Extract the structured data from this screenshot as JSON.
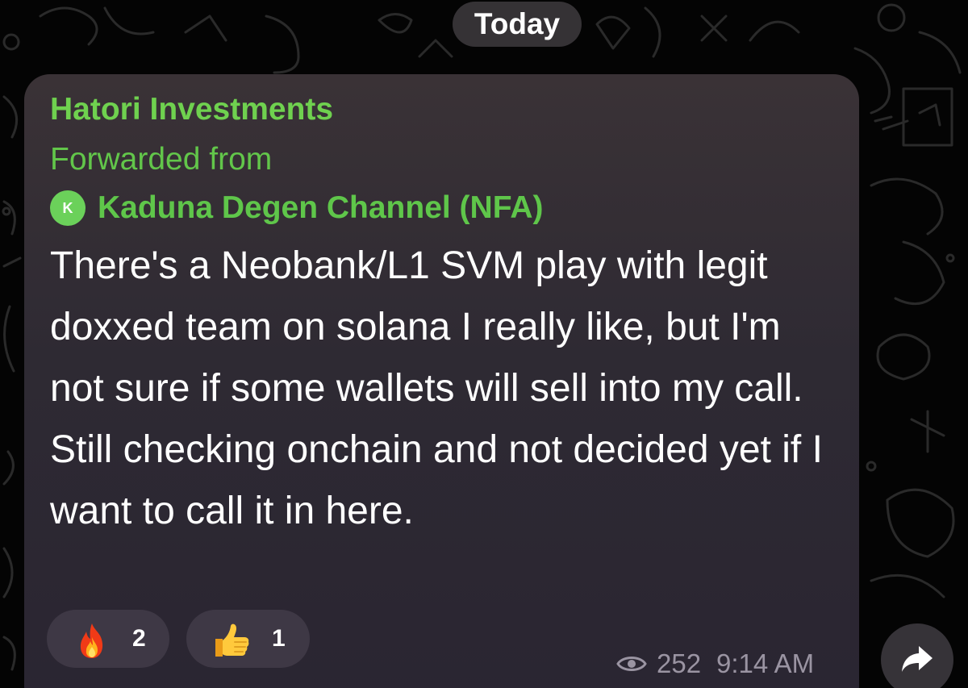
{
  "date_separator": "Today",
  "message": {
    "sender": "Hatori Investments",
    "forwarded_label": "Forwarded from",
    "forwarded_source": {
      "avatar_letter": "K",
      "avatar_color": "#6bd15a",
      "name": "Kaduna Degen Channel (NFA)"
    },
    "text": "There's a Neobank/L1 SVM play with legit doxxed team on solana I really like, but I'm not sure if some wallets will sell into my call. Still checking onchain and not decided yet if I want to call it in here.",
    "reactions": [
      {
        "emoji": "fire",
        "count": "2"
      },
      {
        "emoji": "thumbs-up",
        "count": "1"
      }
    ],
    "views": "252",
    "time": "9:14 AM"
  },
  "colors": {
    "name_green": "#6fd14f",
    "bubble": "#2e2a33",
    "meta_gray": "#9a94a2"
  },
  "icons": {
    "views": "eye-icon",
    "share": "share-arrow-icon"
  }
}
